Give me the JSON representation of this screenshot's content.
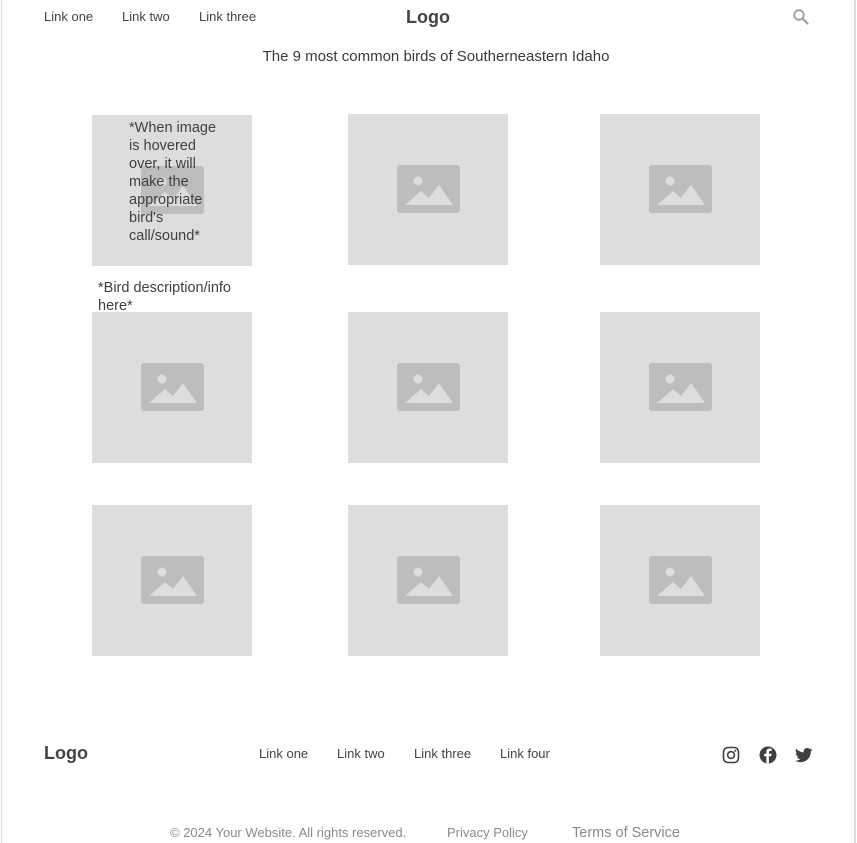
{
  "header": {
    "links": [
      "Link one",
      "Link two",
      "Link three"
    ],
    "logo": "Logo",
    "search_icon": "search-icon"
  },
  "main": {
    "heading": "The 9 most common birds of Southerneastern Idaho",
    "hover_note": "*When image is hovered over, it will make the appropriate bird's call/sound*",
    "description_note": "*Bird description/info here*",
    "tile_icon": "image-placeholder-icon",
    "tile_count": 9
  },
  "footer": {
    "logo": "Logo",
    "links": [
      "Link one",
      "Link two",
      "Link three",
      "Link four"
    ],
    "social_icons": [
      "instagram-icon",
      "facebook-icon",
      "twitter-icon"
    ],
    "copyright": "© 2024 Your Website. All rights reserved.",
    "privacy": "Privacy Policy",
    "terms": "Terms of Service"
  },
  "colors": {
    "tile_bg": "#dddddd",
    "tile_icon": "#bdbdbd",
    "text": "#444444",
    "muted": "#8a8a8a"
  }
}
